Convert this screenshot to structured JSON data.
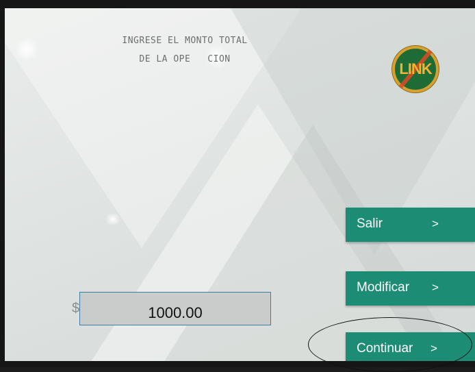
{
  "prompt": {
    "line1": "INGRESE EL MONTO TOTAL",
    "line2": "DE LA OPE   CION"
  },
  "logo": {
    "text": "LINK",
    "icon": "link-logo"
  },
  "amount": {
    "currency": "$",
    "value": "1000.00"
  },
  "buttons": {
    "salir": {
      "label": "Salir",
      "chevron": ">"
    },
    "modificar": {
      "label": "Modificar",
      "chevron": ">"
    },
    "continuar": {
      "label": "Continuar",
      "chevron": ">"
    }
  },
  "colors": {
    "button": "#1d8c74",
    "logo_bg": "#1f6b35",
    "logo_ring": "#d7a12f",
    "logo_text": "#f3b234"
  }
}
